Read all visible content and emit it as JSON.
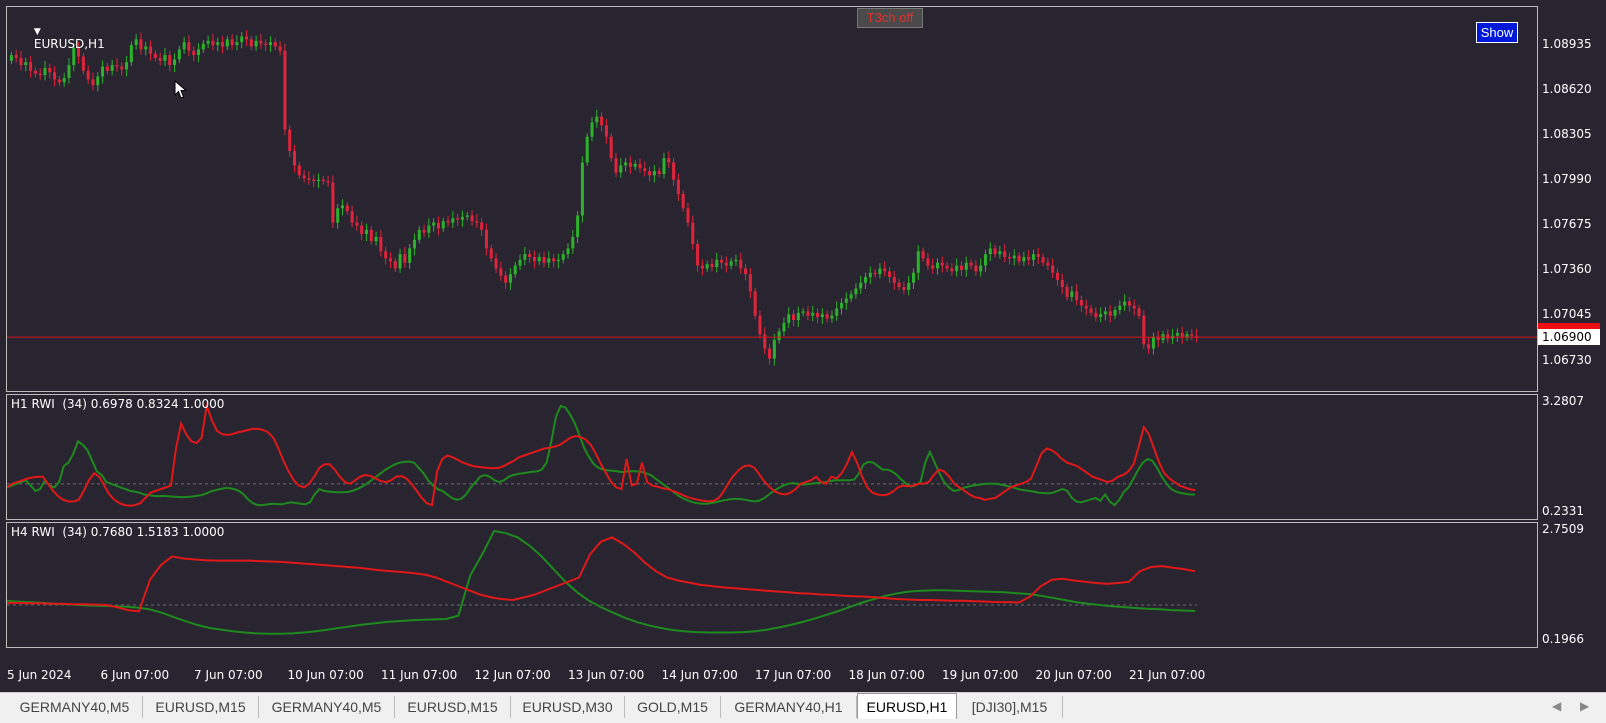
{
  "main_chart": {
    "title": "EURUSD,H1",
    "t3ch_label": "T3ch off",
    "show_label": "Show",
    "price_ticks": [
      "1.08935",
      "1.08620",
      "1.08305",
      "1.07990",
      "1.07675",
      "1.07360",
      "1.07045",
      "1.06730"
    ],
    "current_price": "1.06900",
    "price_range": [
      1.0658,
      1.0915
    ],
    "current_price_value": 1.069,
    "bull_color": "#2db22d",
    "bear_color": "#e0243c",
    "candle_closes": [
      1.0887,
      1.0885,
      1.088,
      1.0882,
      1.0876,
      1.0874,
      1.0873,
      1.0878,
      1.0875,
      1.087,
      1.0868,
      1.0871,
      1.088,
      1.0892,
      1.0886,
      1.0876,
      1.087,
      1.0866,
      1.0872,
      1.0879,
      1.0876,
      1.088,
      1.0879,
      1.0877,
      1.0882,
      1.0894,
      1.0898,
      1.0891,
      1.0893,
      1.0888,
      1.0885,
      1.0883,
      1.0887,
      1.088,
      1.0884,
      1.0891,
      1.0896,
      1.089,
      1.0887,
      1.0891,
      1.0895,
      1.0897,
      1.0894,
      1.0896,
      1.0893,
      1.0898,
      1.0894,
      1.0896,
      1.09,
      1.0898,
      1.0893,
      1.0897,
      1.0895,
      1.0894,
      1.0896,
      1.0893,
      1.089,
      1.0835,
      1.082,
      1.081,
      1.0803,
      1.0801,
      1.08,
      1.0799,
      1.08,
      1.0799,
      1.0798,
      1.077,
      1.078,
      1.0782,
      1.0778,
      1.077,
      1.0768,
      1.0762,
      1.0765,
      1.0757,
      1.076,
      1.075,
      1.0745,
      1.0743,
      1.0738,
      1.0748,
      1.0742,
      1.0752,
      1.0758,
      1.0765,
      1.0763,
      1.0768,
      1.077,
      1.0766,
      1.0771,
      1.077,
      1.0773,
      1.0772,
      1.0774,
      1.0775,
      1.0771,
      1.077,
      1.0765,
      1.0752,
      1.0745,
      1.0738,
      1.0733,
      1.0728,
      1.0734,
      1.074,
      1.0744,
      1.0748,
      1.0746,
      1.0743,
      1.0746,
      1.0742,
      1.0745,
      1.0743,
      1.0744,
      1.0748,
      1.0752,
      1.076,
      1.0775,
      1.0812,
      1.083,
      1.084,
      1.0844,
      1.0838,
      1.083,
      1.0815,
      1.0805,
      1.081,
      1.0812,
      1.0809,
      1.0811,
      1.0808,
      1.0806,
      1.0803,
      1.0806,
      1.0804,
      1.0815,
      1.0812,
      1.08,
      1.079,
      1.078,
      1.077,
      1.0755,
      1.074,
      1.0738,
      1.0741,
      1.0739,
      1.0744,
      1.0742,
      1.074,
      1.0743,
      1.0744,
      1.0738,
      1.0734,
      1.0722,
      1.0705,
      1.0692,
      1.0682,
      1.0675,
      1.0688,
      1.0694,
      1.07,
      1.0706,
      1.0702,
      1.0707,
      1.0708,
      1.0705,
      1.0707,
      1.0704,
      1.0706,
      1.0703,
      1.0705,
      1.071,
      1.0714,
      1.0717,
      1.072,
      1.0724,
      1.0728,
      1.0732,
      1.0735,
      1.0734,
      1.0738,
      1.0736,
      1.0732,
      1.0728,
      1.0725,
      1.0723,
      1.0728,
      1.0735,
      1.075,
      1.0745,
      1.074,
      1.0738,
      1.0742,
      1.074,
      1.0738,
      1.0736,
      1.074,
      1.0737,
      1.0742,
      1.074,
      1.0736,
      1.074,
      1.0748,
      1.0752,
      1.0748,
      1.075,
      1.0746,
      1.0745,
      1.0747,
      1.0743,
      1.0746,
      1.0744,
      1.0748,
      1.0746,
      1.0742,
      1.074,
      1.0735,
      1.073,
      1.0725,
      1.0718,
      1.0722,
      1.0716,
      1.0712,
      1.071,
      1.0707,
      1.0704,
      1.0706,
      1.0708,
      1.0705,
      1.0709,
      1.0712,
      1.0715,
      1.0712,
      1.071,
      1.0705,
      1.0685,
      1.0682,
      1.069,
      1.0688,
      1.0692,
      1.0689,
      1.0691,
      1.0693,
      1.069,
      1.0692,
      1.0691,
      1.069
    ]
  },
  "h1_rwi": {
    "label": "H1 RWI  (34) 0.6978 0.8324 1.0000",
    "ticks": [
      "3.2807",
      "0.2331"
    ],
    "range": [
      0.2331,
      3.2807
    ],
    "level": 1.0,
    "high_color": "#1e8a1e",
    "low_color": "#e01818",
    "green": [
      0.9,
      0.95,
      1.0,
      1.05,
      1.1,
      0.95,
      0.8,
      0.85,
      1.1,
      0.95,
      0.9,
      1.05,
      1.5,
      1.6,
      1.85,
      2.2,
      2.1,
      1.95,
      1.65,
      1.35,
      1.25,
      1.05,
      1.0,
      0.95,
      0.9,
      0.85,
      0.8,
      0.78,
      0.75,
      0.7,
      0.68,
      0.66,
      0.65,
      0.66,
      0.65,
      0.64,
      0.63,
      0.62,
      0.63,
      0.64,
      0.66,
      0.68,
      0.72,
      0.78,
      0.82,
      0.85,
      0.88,
      0.88,
      0.85,
      0.8,
      0.7,
      0.55,
      0.45,
      0.4,
      0.4,
      0.42,
      0.44,
      0.43,
      0.42,
      0.45,
      0.48,
      0.46,
      0.44,
      0.42,
      0.48,
      0.7,
      0.85,
      0.8,
      0.78,
      0.77,
      0.76,
      0.76,
      0.77,
      0.8,
      0.85,
      0.92,
      1.0,
      1.1,
      1.2,
      1.3,
      1.4,
      1.48,
      1.55,
      1.6,
      1.62,
      1.63,
      1.6,
      1.45,
      1.3,
      1.1,
      0.95,
      0.85,
      0.8,
      0.7,
      0.6,
      0.55,
      0.58,
      0.7,
      0.9,
      1.05,
      1.2,
      1.25,
      1.2,
      1.1,
      1.05,
      1.1,
      1.2,
      1.25,
      1.28,
      1.3,
      1.32,
      1.34,
      1.35,
      1.4,
      1.6,
      2.2,
      2.9,
      3.2,
      3.15,
      2.95,
      2.7,
      2.35,
      2.0,
      1.75,
      1.55,
      1.45,
      1.4,
      1.38,
      1.37,
      1.35,
      1.33,
      1.35,
      1.36,
      1.35,
      1.34,
      1.3,
      1.25,
      1.15,
      1.05,
      0.95,
      0.85,
      0.75,
      0.65,
      0.58,
      0.52,
      0.48,
      0.45,
      0.44,
      0.44,
      0.46,
      0.49,
      0.52,
      0.55,
      0.57,
      0.58,
      0.57,
      0.55,
      0.52,
      0.5,
      0.53,
      0.6,
      0.7,
      0.8,
      0.88,
      0.95,
      1.0,
      1.02,
      1.0,
      0.98,
      0.99,
      1.0,
      1.02,
      1.03,
      1.05,
      1.08,
      1.1,
      1.1,
      1.1,
      1.1,
      1.12,
      1.3,
      1.55,
      1.62,
      1.6,
      1.5,
      1.4,
      1.4,
      1.35,
      1.25,
      1.12,
      1.0,
      0.92,
      0.96,
      1.05,
      1.6,
      1.9,
      1.6,
      1.3,
      1.05,
      0.9,
      0.8,
      0.82,
      0.88,
      0.92,
      0.95,
      0.97,
      0.99,
      1.0,
      1.0,
      1.0,
      0.98,
      0.95,
      0.92,
      0.88,
      0.84,
      0.82,
      0.8,
      0.78,
      0.75,
      0.74,
      0.73,
      0.75,
      0.8,
      0.85,
      0.8,
      0.6,
      0.5,
      0.48,
      0.52,
      0.56,
      0.6,
      0.52,
      0.7,
      0.5,
      0.4,
      0.55,
      0.78,
      0.9,
      1.15,
      1.4,
      1.6,
      1.7,
      1.65,
      1.45,
      1.2,
      1.0,
      0.85,
      0.78,
      0.74,
      0.72,
      0.7,
      0.7
    ],
    "red": [
      0.9,
      1.0,
      1.05,
      1.1,
      1.15,
      1.18,
      1.2,
      1.2,
      1.0,
      0.8,
      0.65,
      0.55,
      0.5,
      0.5,
      0.55,
      0.8,
      1.1,
      1.3,
      1.2,
      0.95,
      0.7,
      0.55,
      0.45,
      0.4,
      0.38,
      0.4,
      0.45,
      0.6,
      0.75,
      0.8,
      0.85,
      0.9,
      0.95,
      2.0,
      2.7,
      2.4,
      2.2,
      2.15,
      2.3,
      3.2,
      2.8,
      2.5,
      2.4,
      2.38,
      2.4,
      2.45,
      2.48,
      2.52,
      2.55,
      2.55,
      2.52,
      2.45,
      2.3,
      2.0,
      1.65,
      1.35,
      1.1,
      0.95,
      0.9,
      1.0,
      1.2,
      1.45,
      1.55,
      1.55,
      1.4,
      1.2,
      1.05,
      1.0,
      1.1,
      1.2,
      1.25,
      1.22,
      1.15,
      1.08,
      1.05,
      1.1,
      1.2,
      1.22,
      1.15,
      1.0,
      0.8,
      0.6,
      0.45,
      0.4,
      1.35,
      1.7,
      1.8,
      1.75,
      1.68,
      1.6,
      1.55,
      1.5,
      1.48,
      1.46,
      1.45,
      1.44,
      1.45,
      1.5,
      1.58,
      1.65,
      1.75,
      1.8,
      1.85,
      1.9,
      1.95,
      2.0,
      2.02,
      2.05,
      2.1,
      2.2,
      2.3,
      2.35,
      2.32,
      2.25,
      2.1,
      1.85,
      1.55,
      1.3,
      1.05,
      0.9,
      0.85,
      1.7,
      0.95,
      1.0,
      1.6,
      1.05,
      0.95,
      0.92,
      0.88,
      0.85,
      0.8,
      0.75,
      0.68,
      0.62,
      0.58,
      0.55,
      0.52,
      0.5,
      0.52,
      0.6,
      0.8,
      1.05,
      1.25,
      1.4,
      1.5,
      1.52,
      1.45,
      1.25,
      1.05,
      0.9,
      0.78,
      0.72,
      0.7,
      0.75,
      0.85,
      1.0,
      1.05,
      1.1,
      1.2,
      1.05,
      1.0,
      1.2,
      1.15,
      1.3,
      1.55,
      1.9,
      1.6,
      1.2,
      0.9,
      0.75,
      0.7,
      0.68,
      0.7,
      0.78,
      0.9,
      0.95,
      0.93,
      0.95,
      1.0,
      1.0,
      1.05,
      1.25,
      1.4,
      1.35,
      1.2,
      1.0,
      0.9,
      0.8,
      0.7,
      0.62,
      0.6,
      0.55,
      0.58,
      0.6,
      0.7,
      0.8,
      0.9,
      0.95,
      1.0,
      1.05,
      1.15,
      1.5,
      1.85,
      2.0,
      1.95,
      1.85,
      1.7,
      1.6,
      1.55,
      1.5,
      1.4,
      1.3,
      1.2,
      1.15,
      1.1,
      1.05,
      1.1,
      1.2,
      1.25,
      1.35,
      1.55,
      2.05,
      2.6,
      2.4,
      2.0,
      1.6,
      1.3,
      1.15,
      1.05,
      0.95,
      0.9,
      0.85,
      0.82
    ]
  },
  "h4_rwi": {
    "label": "H4 RWI  (34) 0.7680 1.5183 1.0000",
    "ticks": [
      "2.7509",
      "0.1966"
    ],
    "range": [
      0.1966,
      2.7509
    ],
    "level": 1.0,
    "high_color": "#1e8a1e",
    "low_color": "#e01818",
    "green": [
      1.1,
      1.08,
      1.07,
      1.05,
      1.03,
      1.02,
      1.0,
      0.99,
      0.98,
      0.97,
      0.96,
      0.94,
      0.9,
      0.82,
      0.72,
      0.62,
      0.53,
      0.46,
      0.42,
      0.38,
      0.35,
      0.33,
      0.32,
      0.32,
      0.33,
      0.35,
      0.38,
      0.42,
      0.46,
      0.5,
      0.54,
      0.57,
      0.6,
      0.62,
      0.64,
      0.65,
      0.66,
      0.67,
      0.75,
      1.7,
      2.2,
      2.75,
      2.7,
      2.6,
      2.4,
      2.15,
      1.85,
      1.55,
      1.3,
      1.1,
      0.95,
      0.82,
      0.7,
      0.6,
      0.52,
      0.46,
      0.41,
      0.38,
      0.36,
      0.35,
      0.35,
      0.35,
      0.36,
      0.38,
      0.42,
      0.47,
      0.53,
      0.6,
      0.68,
      0.77,
      0.86,
      0.96,
      1.06,
      1.14,
      1.22,
      1.28,
      1.32,
      1.34,
      1.35,
      1.35,
      1.34,
      1.33,
      1.32,
      1.31,
      1.3,
      1.28,
      1.26,
      1.22,
      1.17,
      1.12,
      1.07,
      1.03,
      1.0,
      0.97,
      0.95,
      0.93,
      0.91,
      0.9,
      0.88,
      0.87,
      0.86
    ],
    "red": [
      1.05,
      1.05,
      1.04,
      1.04,
      1.03,
      1.03,
      1.02,
      1.02,
      1.01,
      1.0,
      0.95,
      0.88,
      0.85,
      1.6,
      1.95,
      2.15,
      2.1,
      2.08,
      2.06,
      2.05,
      2.05,
      2.05,
      2.05,
      2.04,
      2.03,
      2.02,
      2.0,
      1.98,
      1.96,
      1.94,
      1.92,
      1.9,
      1.88,
      1.85,
      1.82,
      1.8,
      1.78,
      1.75,
      1.72,
      1.65,
      1.55,
      1.45,
      1.35,
      1.25,
      1.18,
      1.14,
      1.12,
      1.18,
      1.25,
      1.35,
      1.45,
      1.55,
      1.65,
      2.2,
      2.5,
      2.6,
      2.45,
      2.25,
      2.0,
      1.8,
      1.65,
      1.58,
      1.53,
      1.48,
      1.45,
      1.42,
      1.4,
      1.38,
      1.36,
      1.34,
      1.32,
      1.3,
      1.28,
      1.27,
      1.25,
      1.24,
      1.22,
      1.21,
      1.2,
      1.18,
      1.16,
      1.14,
      1.13,
      1.12,
      1.12,
      1.11,
      1.1,
      1.1,
      1.09,
      1.08,
      1.07,
      1.07,
      1.06,
      1.2,
      1.45,
      1.6,
      1.62,
      1.58,
      1.55,
      1.52,
      1.5,
      1.52,
      1.55,
      1.8,
      1.9,
      1.92,
      1.88,
      1.85,
      1.8
    ]
  },
  "time_axis": {
    "labels": [
      "5 Jun 2024",
      "6 Jun 07:00",
      "7 Jun 07:00",
      "10 Jun 07:00",
      "11 Jun 07:00",
      "12 Jun 07:00",
      "13 Jun 07:00",
      "14 Jun 07:00",
      "17 Jun 07:00",
      "18 Jun 07:00",
      "19 Jun 07:00",
      "20 Jun 07:00",
      "21 Jun 07:00"
    ]
  },
  "tabs": [
    {
      "label": "GERMANY40,M5",
      "active": false
    },
    {
      "label": "EURUSD,M15",
      "active": false
    },
    {
      "label": "GERMANY40,M5",
      "active": false
    },
    {
      "label": "EURUSD,M15",
      "active": false
    },
    {
      "label": "EURUSD,M30",
      "active": false
    },
    {
      "label": "GOLD,M15",
      "active": false
    },
    {
      "label": "GERMANY40,H1",
      "active": false
    },
    {
      "label": "EURUSD,H1",
      "active": true
    },
    {
      "label": "[DJI30],M15",
      "active": false
    }
  ],
  "icons": {
    "dropdown": "triangle-down-icon",
    "cursor": "mouse-pointer-icon",
    "scroll_left": "chevron-left-icon",
    "scroll_right": "chevron-right-icon"
  }
}
